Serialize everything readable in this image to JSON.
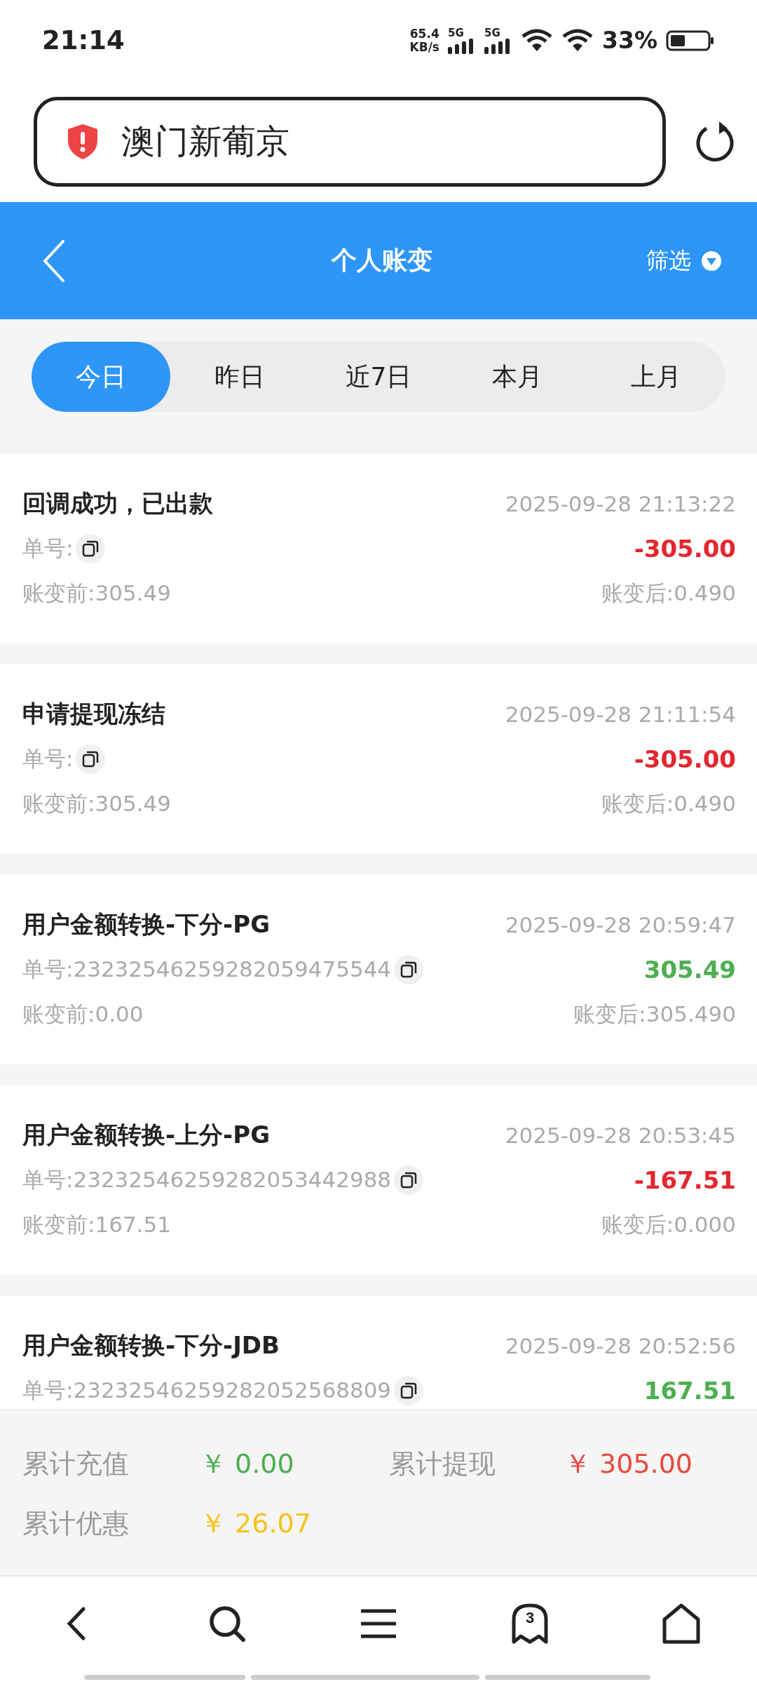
{
  "status_bar": {
    "time": "21:14",
    "net_speed": "65.4",
    "net_unit": "KB/s",
    "sim_labels": [
      "5G",
      "5G"
    ],
    "battery": "33%"
  },
  "address_bar": {
    "title": "澳门新葡京"
  },
  "header": {
    "title": "个人账变",
    "filter": "筛选"
  },
  "tabs": [
    {
      "label": "今日",
      "selected": true
    },
    {
      "label": "昨日",
      "selected": false
    },
    {
      "label": "近7日",
      "selected": false
    },
    {
      "label": "本月",
      "selected": false
    },
    {
      "label": "上月",
      "selected": false
    }
  ],
  "records": [
    {
      "title": "回调成功，已出款",
      "time": "2025-09-28 21:13:22",
      "order": "单号:",
      "amount": "-305.00",
      "kind": "debit",
      "before": "账变前:305.49",
      "after": "账变后:0.490"
    },
    {
      "title": "申请提现冻结",
      "time": "2025-09-28 21:11:54",
      "order": "单号:",
      "amount": "-305.00",
      "kind": "debit",
      "before": "账变前:305.49",
      "after": "账变后:0.490"
    },
    {
      "title": "用户金额转换-下分-PG",
      "time": "2025-09-28 20:59:47",
      "order": "单号:23232546259282059475544",
      "amount": "305.49",
      "kind": "credit",
      "before": "账变前:0.00",
      "after": "账变后:305.490"
    },
    {
      "title": "用户金额转换-上分-PG",
      "time": "2025-09-28 20:53:45",
      "order": "单号:23232546259282053442988",
      "amount": "-167.51",
      "kind": "debit",
      "before": "账变前:167.51",
      "after": "账变后:0.000"
    },
    {
      "title": "用户金额转换-下分-JDB",
      "time": "2025-09-28 20:52:56",
      "order": "单号:23232546259282052568809",
      "amount": "167.51",
      "kind": "credit"
    }
  ],
  "summary": [
    {
      "label": "累计充值",
      "value": "￥ 0.00",
      "color": "#4caf50"
    },
    {
      "label": "累计提现",
      "value": "￥ 305.00",
      "color": "#e84a3c"
    },
    {
      "label": "累计优惠",
      "value": "￥ 26.07",
      "color": "#f5c31c"
    }
  ],
  "bottom_nav": {
    "tab_count": "3"
  }
}
